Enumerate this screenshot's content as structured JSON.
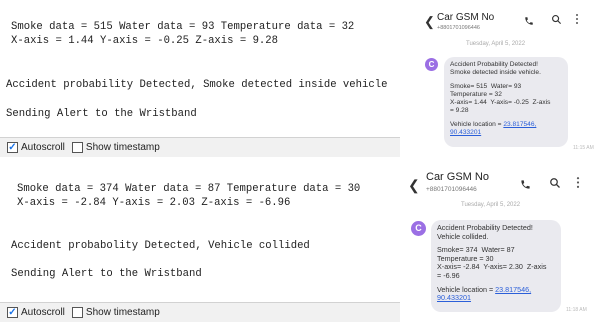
{
  "serial_top": {
    "lines": [
      "Smoke data = 515 Water data = 93 Temperature data = 32",
      "X-axis = 1.44 Y-axis = -0.25 Z-axis = 9.28",
      "Accident probability Detected, Smoke detected inside vehicle",
      "Sending Alert to the Wristband"
    ],
    "autoscroll_label": "Autoscroll",
    "autoscroll_checked": true,
    "timestamp_label": "Show timestamp",
    "timestamp_checked": false
  },
  "serial_bottom": {
    "lines": [
      "Smoke data = 374 Water data = 87 Temperature data = 30",
      "X-axis = -2.84 Y-axis = 2.03 Z-axis = -6.96",
      "Accident probabolity Detected, Vehicle collided",
      "Sending Alert to the Wristband"
    ],
    "autoscroll_label": "Autoscroll",
    "autoscroll_checked": true,
    "timestamp_label": "Show timestamp",
    "timestamp_checked": false
  },
  "sms_top": {
    "contact_name": "Car GSM No",
    "contact_number": "+8801701096446",
    "date": "Tuesday, April 5, 2022",
    "avatar_letter": "C",
    "message_lines": [
      "Accident Probability Detected!",
      "Smoke detected inside vehicle.",
      "",
      "Smoke= 515  Water= 93",
      "Temperature = 32",
      "X-axis= 1.44  Y-axis= -0.25  Z-axis",
      "= 9.28"
    ],
    "location_label": "Vehicle location = ",
    "location_link_1": "23.817546,",
    "location_link_2": "90.433201",
    "time": "11:15 AM"
  },
  "sms_bottom": {
    "contact_name": "Car GSM No",
    "contact_number": "+8801701096446",
    "date": "Tuesday, April 5, 2022",
    "avatar_letter": "C",
    "message_lines": [
      "Accident Probability Detected!",
      "Vehicle collided.",
      "",
      "Smoke= 374  Water= 87",
      "Temperature = 30",
      "X-axis= -2.84  Y-axis= 2.30  Z-axis",
      "= -6.96"
    ],
    "location_label": "Vehicle location = ",
    "location_link_1": "23.817546,",
    "location_link_2": "90.433201",
    "time": "11:18 AM"
  },
  "icons": {
    "back": "chevron-left-icon",
    "call": "phone-icon",
    "search": "search-icon",
    "more": "more-vertical-icon",
    "check": "check-icon"
  },
  "colors": {
    "avatar": "#9b6fe4",
    "bubble": "#eaeaef",
    "link": "#2b5fd9",
    "check": "#1a73e8"
  }
}
